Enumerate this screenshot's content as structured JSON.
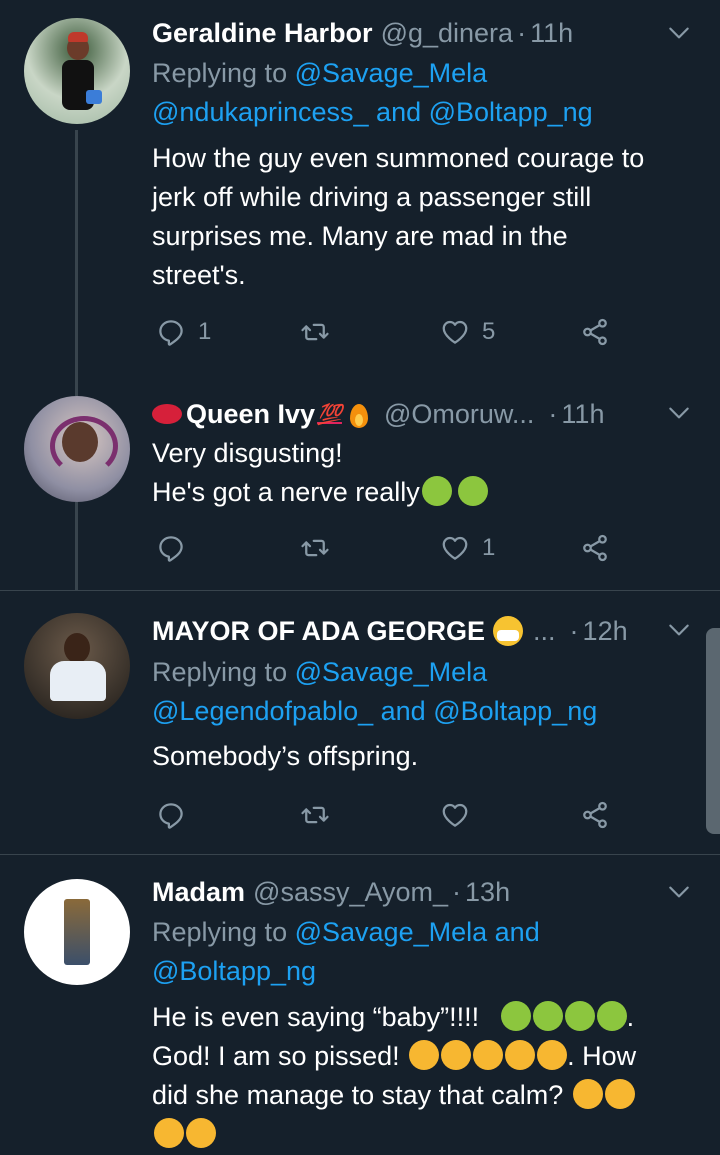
{
  "tweets": [
    {
      "name": "Geraldine Harbor",
      "handle": "@g_dinera",
      "dot": "·",
      "time": "11h",
      "reply_prefix": "Replying to",
      "reply_1": "@Savage_Mela",
      "reply_2a": "@ndukaprincess_",
      "reply_and": "and",
      "reply_2b": "@Boltapp_ng",
      "text": [
        "How the guy even summoned courage to",
        "jerk off while driving a passenger still",
        "surprises me. Many are mad in the",
        "street's."
      ],
      "reply_count": "1",
      "like_count": "5"
    },
    {
      "name": "Queen Ivy",
      "name_suffix": "💯",
      "handle": "@Omoruw...",
      "dot": "·",
      "time": "11h",
      "text_1": "Very disgusting!",
      "text_2": "He's got a nerve really",
      "reply_count": "",
      "like_count": "1"
    },
    {
      "name": "MAYOR OF ADA GEORGE",
      "ellipsis": "...",
      "dot": "·",
      "time": "12h",
      "reply_prefix": "Replying to",
      "reply_1": "@Savage_Mela",
      "reply_2a": "@Legendofpablo_",
      "reply_and": "and",
      "reply_2b": "@Boltapp_ng",
      "text": "Somebody’s offspring."
    },
    {
      "name": "Madam",
      "handle": "@sassy_Ayom_",
      "dot": "·",
      "time": "13h",
      "reply_prefix": "Replying to",
      "reply_1": "@Savage_Mela",
      "reply_and": "and",
      "reply_2": "@Boltapp_ng",
      "text_1": "He is even saying “baby”!!!!",
      "text_1_end": ".",
      "text_2": "God! I am so pissed!",
      "text_2_end": ". How",
      "text_3": "did she manage to stay that calm?"
    }
  ],
  "colors": {
    "background": "#15202b",
    "text": "#ffffff",
    "muted": "#8899a6",
    "link": "#1da1f2",
    "divider": "#38444d"
  },
  "icons": [
    "reply-icon",
    "retweet-icon",
    "like-icon",
    "share-icon",
    "chevron-down-icon",
    "nauseated-face-emoji",
    "crying-face-emoji",
    "weary-face-emoji",
    "mask-face-emoji",
    "fire-emoji",
    "kiss-lips-emoji"
  ]
}
